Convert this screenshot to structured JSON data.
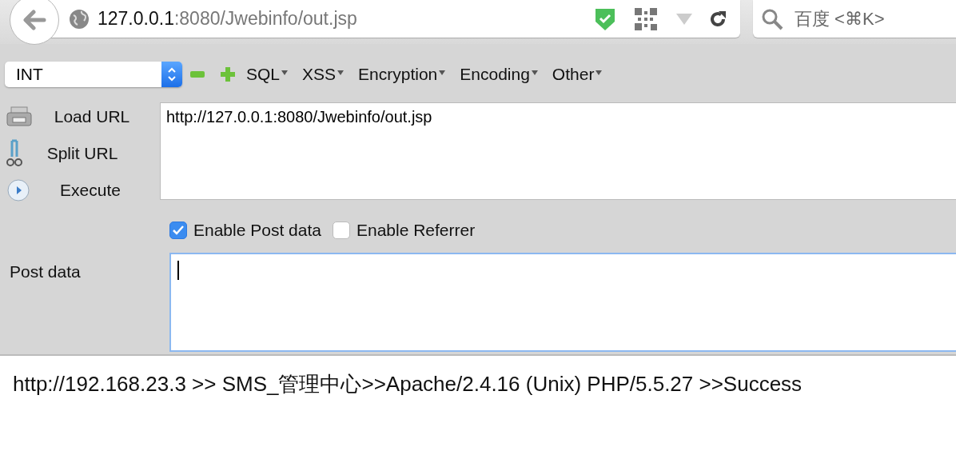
{
  "address_bar": {
    "host": "127.0.0.1",
    "path": ":8080/Jwebinfo/out.jsp"
  },
  "search": {
    "placeholder": "百度 <⌘K>"
  },
  "hackbar": {
    "select": {
      "value": "INT"
    },
    "menus": [
      {
        "label": "SQL"
      },
      {
        "label": "XSS"
      },
      {
        "label": "Encryption"
      },
      {
        "label": "Encoding"
      },
      {
        "label": "Other"
      }
    ],
    "actions": [
      {
        "kind": "load",
        "label": "Load URL"
      },
      {
        "kind": "split",
        "label": "Split URL"
      },
      {
        "kind": "execute",
        "label": "Execute"
      }
    ],
    "url_field": {
      "value": "http://127.0.0.1:8080/Jwebinfo/out.jsp"
    },
    "options": [
      {
        "label": "Enable Post data",
        "checked": true
      },
      {
        "label": "Enable Referrer",
        "checked": false
      }
    ],
    "post_label": "Post data",
    "post_field": {
      "focused": true
    }
  },
  "page_text": "http://192.168.23.3 >> SMS_管理中心>>Apache/2.4.16 (Unix) PHP/5.5.27 >>Success"
}
